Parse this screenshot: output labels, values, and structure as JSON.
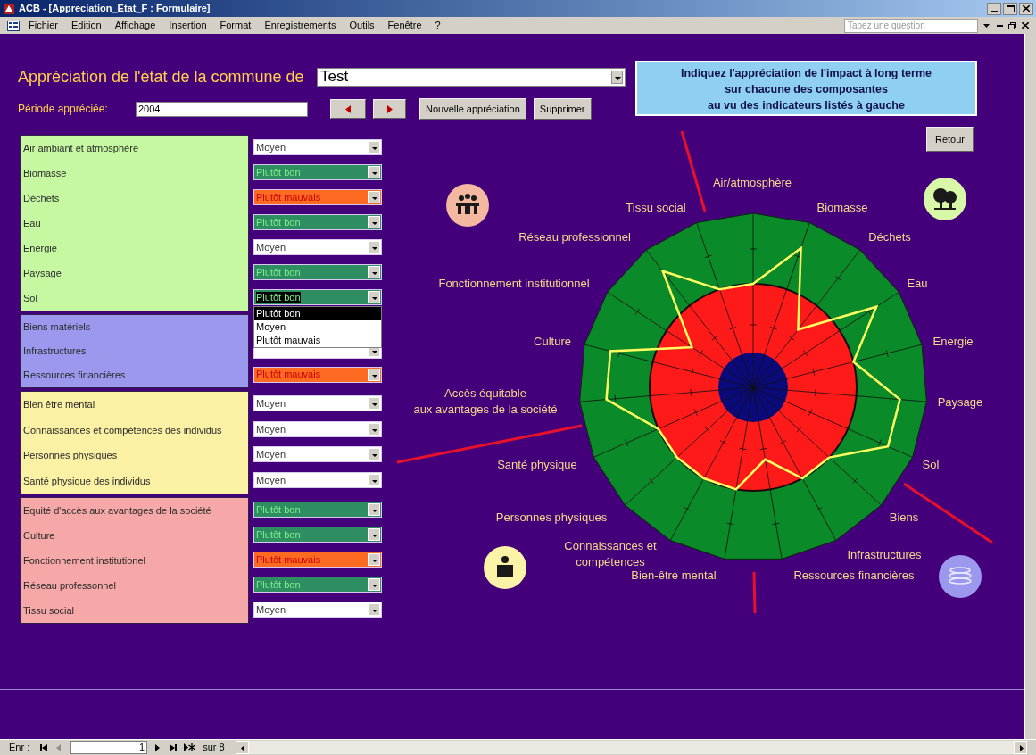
{
  "window": {
    "title": "ACB - [Appreciation_Etat_F : Formulaire]"
  },
  "menu": [
    "Fichier",
    "Edition",
    "Affichage",
    "Insertion",
    "Format",
    "Enregistrements",
    "Outils",
    "Fenêtre",
    "?"
  ],
  "help_search": {
    "placeholder": "Tapez une question"
  },
  "header": {
    "title": "Appréciation de l'état de la commune de",
    "commune": "Test",
    "period_label": "Période appréciée:",
    "period": "2004",
    "buttons": [
      "Nouvelle appréciation",
      "Supprimer"
    ],
    "instruction": "Indiquez l'appréciation de l'impact à long terme\nsur chacune des composantes\nau vu des indicateurs listés à gauche"
  },
  "groups": [
    {
      "color": "#c6f8a2",
      "rows": [
        {
          "label": "Air ambiant et atmosphère",
          "value": "Moyen",
          "kind": "medium",
          "open": false
        },
        {
          "label": "Biomasse",
          "value": "Plutôt bon",
          "kind": "good",
          "open": false
        },
        {
          "label": "Déchets",
          "value": "Plutôt mauvais",
          "kind": "bad",
          "open": false
        },
        {
          "label": "Eau",
          "value": "Plutôt bon",
          "kind": "good",
          "open": false
        },
        {
          "label": "Energie",
          "value": "Moyen",
          "kind": "medium",
          "open": false
        },
        {
          "label": "Paysage",
          "value": "Plutôt bon",
          "kind": "good",
          "open": false
        },
        {
          "label": "Sol",
          "value": "Plutôt bon",
          "kind": "good",
          "open": true,
          "options": [
            {
              "label": "Plutôt bon",
              "selected": true
            },
            {
              "label": "Moyen",
              "selected": false
            },
            {
              "label": "Plutôt mauvais",
              "selected": false
            }
          ]
        }
      ]
    },
    {
      "color": "#9c98ee",
      "rows": [
        {
          "label": "Biens matériels"
        },
        {
          "label": "Infrastructures",
          "kind": "medium"
        },
        {
          "label": "Ressources financières",
          "value": "Plutôt mauvais",
          "kind": "bad",
          "open": false
        }
      ]
    },
    {
      "color": "#fbf1a4",
      "rows": [
        {
          "label": "Bien être mental",
          "value": "Moyen",
          "kind": "medium",
          "open": false
        },
        {
          "label": "Connaissances  et compétences des individus",
          "value": "Moyen",
          "kind": "medium",
          "open": false
        },
        {
          "label": "Personnes physiques",
          "value": "Moyen",
          "kind": "medium",
          "open": false
        },
        {
          "label": "Santé physique des individus",
          "value": "Moyen",
          "kind": "medium",
          "open": false
        }
      ]
    },
    {
      "color": "#f6a8a8",
      "rows": [
        {
          "label": "Equité d'accès aux avantages de la société",
          "value": "Plutôt bon",
          "kind": "good",
          "open": false
        },
        {
          "label": "Culture",
          "value": "Plutôt bon",
          "kind": "good",
          "open": false
        },
        {
          "label": "Fonctionnement institutionel",
          "value": "Plutôt mauvais",
          "kind": "bad",
          "open": false
        },
        {
          "label": "Réseau professonnel",
          "value": "Plutôt bon",
          "kind": "good",
          "open": false
        },
        {
          "label": "Tissu social",
          "value": "Moyen",
          "kind": "medium",
          "open": false
        }
      ]
    }
  ],
  "return_button": "Retour",
  "chart": {
    "labels": [
      "Air/atmosphère",
      "Tissu social",
      "Biomasse",
      "Réseau professionnel",
      "Déchets",
      "Fonctionnement institutionnel",
      "Eau",
      "Culture",
      "Energie",
      "Accès équitable\naux avantages de la société",
      "Paysage",
      "Santé physique",
      "Sol",
      "Personnes physiques",
      "Biens",
      "Connaissances et\ncompétences",
      "Infrastructures",
      "Bien-être mental",
      "Ressources financières"
    ]
  },
  "record_nav": {
    "label": "Enr :",
    "current": "1",
    "total": "sur 8"
  }
}
